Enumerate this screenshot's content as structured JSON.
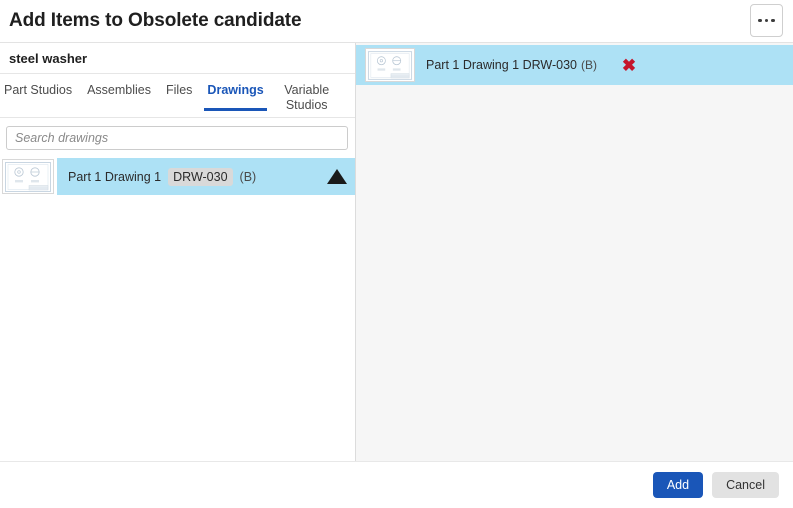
{
  "header": {
    "title": "Add Items to Obsolete candidate",
    "menu_icon": "ellipsis-horizontal-icon"
  },
  "left_panel": {
    "document_name": "steel washer",
    "tabs": [
      {
        "label": "Part Studios",
        "active": false
      },
      {
        "label": "Assemblies",
        "active": false
      },
      {
        "label": "Files",
        "active": false
      },
      {
        "label": "Drawings",
        "active": true
      },
      {
        "label": "Variable Studios",
        "active": false
      }
    ],
    "search": {
      "placeholder": "Search drawings",
      "value": ""
    },
    "results": [
      {
        "name": "Part 1 Drawing 1",
        "part_number": "DRW-030",
        "revision": "(B)",
        "selected": true,
        "expand_icon": "triangle-up-icon",
        "thumbnail": "drawing-thumbnail"
      }
    ]
  },
  "right_panel": {
    "items": [
      {
        "label": "Part 1 Drawing 1 DRW-030",
        "revision": "(B)",
        "remove_icon": "close-x-icon",
        "thumbnail": "drawing-thumbnail"
      }
    ]
  },
  "footer": {
    "add_label": "Add",
    "cancel_label": "Cancel"
  },
  "colors": {
    "accent_blue": "#1a56b8",
    "selection_blue": "#ade1f5",
    "remove_red": "#c4152b",
    "chip_gray": "#d9d9d9",
    "panel_gray": "#f6f6f6"
  }
}
